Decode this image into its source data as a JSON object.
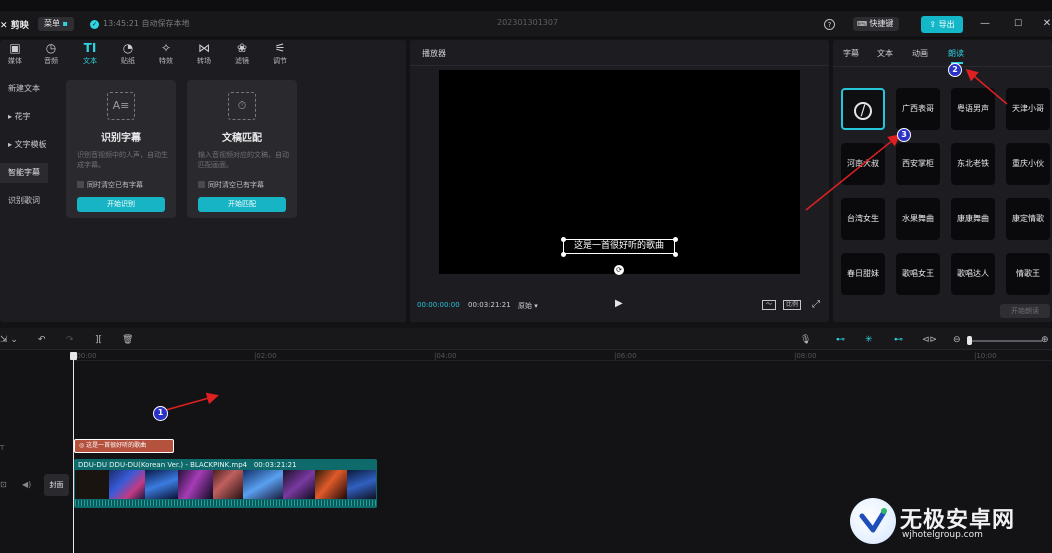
{
  "app": {
    "logo": "剪映",
    "menu": "菜单",
    "autosave": "13:45:21 自动保存本地",
    "project": "202301301307",
    "shortcut": "快捷键",
    "export": "导出"
  },
  "toolbar": [
    "媒体",
    "音频",
    "文本",
    "贴纸",
    "特效",
    "转场",
    "滤镜",
    "调节"
  ],
  "sidebar": [
    "新建文本",
    "花字",
    "文字模板",
    "智能字幕",
    "识别歌词"
  ],
  "cards": [
    {
      "title": "识别字幕",
      "desc": "识别音视频中的人声，自动生成字幕。",
      "check": "同时清空已有字幕",
      "button": "开始识别"
    },
    {
      "title": "文稿匹配",
      "desc": "输入音视频对应的文稿，自动匹配画面。",
      "check": "同时清空已有字幕",
      "button": "开始匹配"
    }
  ],
  "player": {
    "title": "播放器",
    "caption": "这是一首很好听的歌曲",
    "time_current": "00:00:00:00",
    "time_total": "00:03:21:21",
    "ratio": "原始",
    "ratio_btn": "比例"
  },
  "right_tabs": [
    "字幕",
    "文本",
    "动画",
    "朗读"
  ],
  "voices": [
    "广西表哥",
    "粤语男声",
    "天津小哥",
    "河南大叔",
    "西安掌柜",
    "东北老铁",
    "重庆小伙",
    "台湾女生",
    "水果舞曲",
    "康康舞曲",
    "康定情歌",
    "春日甜妹",
    "歌唱女王",
    "歌唱达人",
    "情歌王"
  ],
  "start_read": "开始朗读",
  "ruler": [
    "|00:00",
    "|02:00",
    "|04:00",
    "|06:00",
    "|08:00",
    "|10:00"
  ],
  "text_clip": "这是一首很好听的歌曲",
  "video_clip": {
    "name": "DDU-DU DDU-DU(Korean Ver.) - BLACKPINK.mp4",
    "duration": "00:03:21:21"
  },
  "cover": "封面",
  "annotations": [
    "1",
    "2",
    "3"
  ],
  "watermark": {
    "name": "无极安卓网",
    "url": "wjhotelgroup.com"
  },
  "colors": {
    "accent": "#13b7c8",
    "marker": "#2a32c8",
    "arrow": "#e02020",
    "text_clip": "#b5523e"
  }
}
